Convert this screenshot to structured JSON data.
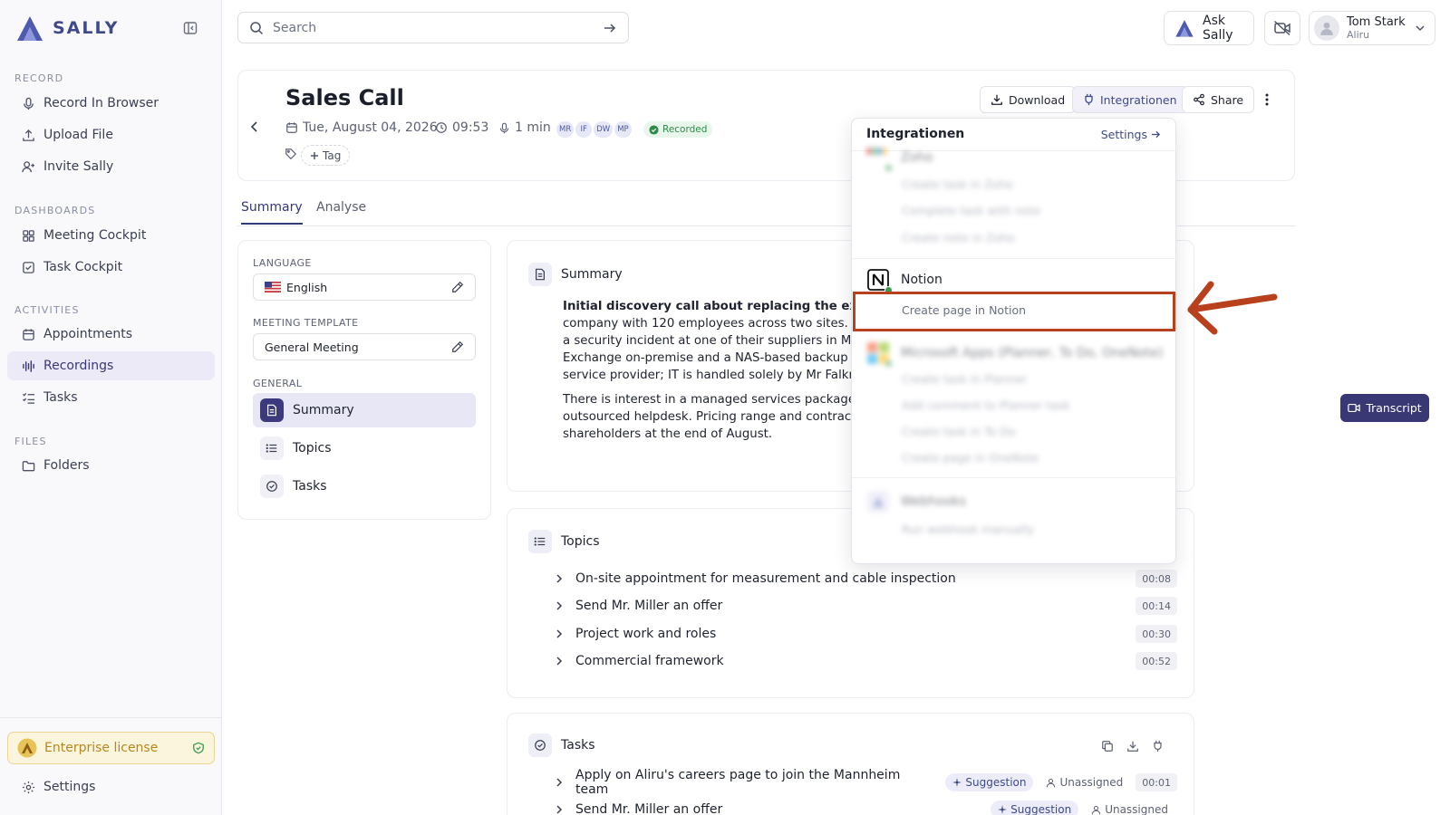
{
  "brand": {
    "name": "SALLY"
  },
  "sidebar": {
    "sections": [
      {
        "title": "RECORD",
        "items": [
          {
            "label": "Record In Browser",
            "icon": "microphone-icon"
          },
          {
            "label": "Upload File",
            "icon": "upload-icon"
          },
          {
            "label": "Invite Sally",
            "icon": "user-plus-icon"
          }
        ]
      },
      {
        "title": "DASHBOARDS",
        "items": [
          {
            "label": "Meeting Cockpit",
            "icon": "grid-icon"
          },
          {
            "label": "Task Cockpit",
            "icon": "checkbox-icon"
          }
        ]
      },
      {
        "title": "ACTIVITIES",
        "items": [
          {
            "label": "Appointments",
            "icon": "calendar-icon"
          },
          {
            "label": "Recordings",
            "icon": "audio-wave-icon",
            "active": true
          },
          {
            "label": "Tasks",
            "icon": "checklist-icon"
          }
        ]
      },
      {
        "title": "FILES",
        "items": [
          {
            "label": "Folders",
            "icon": "folder-icon"
          }
        ]
      }
    ],
    "license": "Enterprise license",
    "settings": "Settings"
  },
  "search": {
    "placeholder": "Search"
  },
  "topbar": {
    "ask_sally": "Ask Sally",
    "user_name": "Tom Stark",
    "user_org": "Aliru"
  },
  "meeting": {
    "title": "Sales Call",
    "date": "Tue, August 04, 2026",
    "time": "09:53",
    "duration": "1 min",
    "participants": [
      "MR",
      "IF",
      "DW",
      "MP"
    ],
    "status": "Recorded",
    "tag_label": "Tag"
  },
  "header_actions": {
    "download": "Download",
    "integrations": "Integrationen",
    "share": "Share"
  },
  "tabs": [
    "Summary",
    "Analyse"
  ],
  "left_panel": {
    "language_label": "LANGUAGE",
    "language": "English",
    "template_label": "MEETING TEMPLATE",
    "template": "General Meeting",
    "general_label": "GENERAL",
    "items": [
      "Summary",
      "Topics",
      "Tasks"
    ]
  },
  "summary": {
    "title": "Summary",
    "bold_line": "Initial discovery call about replacing the existing o",
    "lines": [
      "company with 120 employees across two sites. Trigg",
      "a security incident at one of their suppliers in May. T",
      "Exchange on-premise and a NAS-based backup with",
      "service provider; IT is handled solely by Mr Falkner al"
    ],
    "lines2": [
      "There is interest in a managed services package cov",
      "outsourced helpdesk. Pricing range and contract te",
      "shareholders at the end of August."
    ]
  },
  "topics": {
    "title": "Topics",
    "items": [
      {
        "label": "On-site appointment for measurement and cable inspection",
        "time": "00:08"
      },
      {
        "label": "Send Mr. Miller an offer",
        "time": "00:14"
      },
      {
        "label": "Project work and roles",
        "time": "00:30"
      },
      {
        "label": "Commercial framework",
        "time": "00:52"
      }
    ]
  },
  "tasks": {
    "title": "Tasks",
    "items": [
      {
        "label": "Apply on Aliru's careers page to join the Mannheim team",
        "badge": "Suggestion",
        "assignee": "Unassigned",
        "time": "00:01"
      },
      {
        "label": "Send Mr. Miller an offer",
        "badge": "Suggestion",
        "assignee": "Unassigned",
        "time": ""
      }
    ]
  },
  "transcript_button": "Transcript",
  "integrations_menu": {
    "title": "Integrationen",
    "settings": "Settings",
    "zoho": {
      "name": "Zoho",
      "actions": [
        "Create task in Zoho",
        "Complete task with note",
        "Create note in Zoho"
      ]
    },
    "notion": {
      "name": "Notion",
      "actions": [
        "Create page in Notion"
      ]
    },
    "microsoft": {
      "name": "Microsoft Apps (Planner, To Do, OneNote)",
      "actions": [
        "Create task in Planner",
        "Add comment to Planner task",
        "Create task in To Do",
        "Create page in OneNote"
      ]
    },
    "webhooks": {
      "name": "Webhooks",
      "actions": [
        "Run webhook manually"
      ]
    }
  },
  "colors": {
    "accent": "#3a3874",
    "highlight": "#b8401c",
    "recorded": "#2f8b4a",
    "license": "#b8871c"
  }
}
